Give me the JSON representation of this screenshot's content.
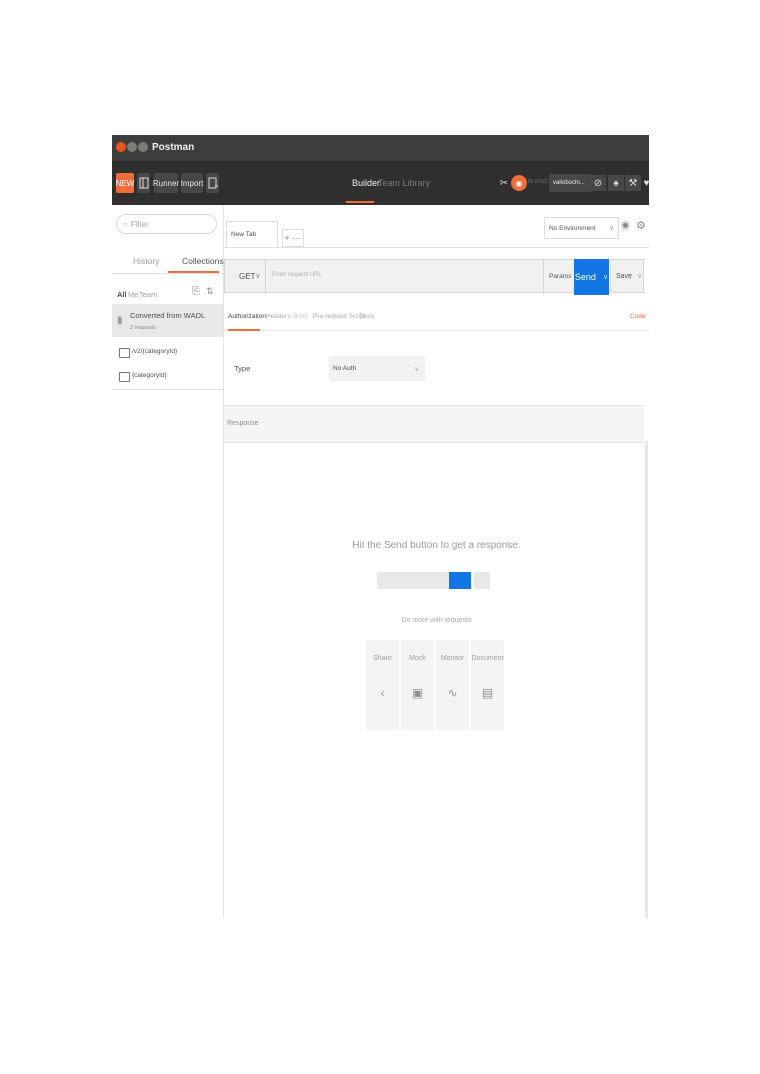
{
  "window": {
    "title": "Postman"
  },
  "header": {
    "new_label": "NEW",
    "runner_label": "Runner",
    "import_label": "Import",
    "tabs": [
      "Builder",
      "Team Library"
    ],
    "sync_label": "IN SYNC",
    "user_label": "valiobochi..."
  },
  "sidebar": {
    "filter_placeholder": "Filter",
    "tabs": [
      "History",
      "Collections"
    ],
    "filters": [
      "All",
      "Me",
      "Team"
    ],
    "collection": {
      "name": "Converted from WADL",
      "count": "2 requests"
    },
    "requests": [
      "/v2/{categoryId}",
      "{categoryId}"
    ]
  },
  "request": {
    "tab_label": "New Tab",
    "environment": "No Environment",
    "method": "GET",
    "url_placeholder": "Enter request URL",
    "params_label": "Params",
    "send_label": "Send",
    "save_label": "Save",
    "tabs": [
      "Authorization",
      "Headers",
      "Body",
      "Pre-request Script",
      "Tests"
    ],
    "code_label": "Code",
    "auth_type_label": "Type",
    "auth_type_value": "No Auth"
  },
  "response": {
    "title": "Response",
    "hint": "Hit the Send button to get a response.",
    "more_text": "Do more with requests",
    "cards": [
      "Share",
      "Mock",
      "Monitor",
      "Document"
    ]
  },
  "colors": {
    "accent": "#f26b3a",
    "send": "#1176e4",
    "titlebar": "#3d3d3b",
    "header": "#2f2f2f"
  }
}
